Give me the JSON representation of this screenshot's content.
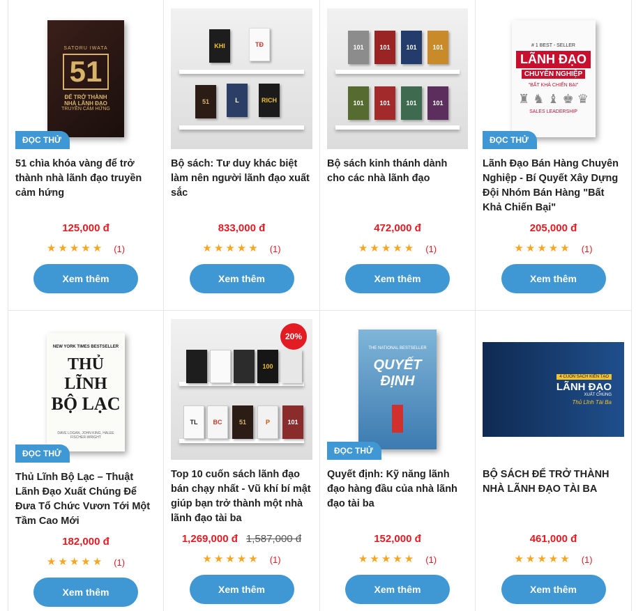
{
  "products": [
    {
      "title": "51 chìa khóa vàng để trở thành nhà lãnh đạo truyền cảm hứng",
      "price": "125,000 đ",
      "rating_count": "(1)",
      "badge": "ĐỌC THỬ",
      "button": "Xem thêm",
      "cover": {
        "author": "SATORU IWATA",
        "big": "51",
        "line1": "ĐỂ TRỞ THÀNH",
        "line2": "NHÀ LÃNH ĐẠO",
        "line3": "TRUYỀN CẢM HỨNG"
      }
    },
    {
      "title": "Bộ sách: Tư duy khác biệt làm nên người lãnh đạo xuất sắc",
      "price": "833,000 đ",
      "rating_count": "(1)",
      "button": "Xem thêm"
    },
    {
      "title": "Bộ sách kinh thánh dành cho các nhà lãnh đạo",
      "price": "472,000 đ",
      "rating_count": "(1)",
      "button": "Xem thêm"
    },
    {
      "title": "Lãnh Đạo Bán Hàng Chuyên Nghiệp - Bí Quyết Xây Dựng Đội Nhóm Bán Hàng \"Bất Khả Chiến Bại\"",
      "price": "205,000 đ",
      "rating_count": "(1)",
      "badge": "ĐỌC THỬ",
      "button": "Xem thêm",
      "cover": {
        "top": "# 1 BEST - SELLER",
        "line1": "LÃNH ĐẠO",
        "line2": "CHUYÊN NGHIỆP",
        "line3": "\"BẤT KHẢ CHIẾN BẠI\"",
        "foot": "SALES LEADERSHIP"
      }
    },
    {
      "title": "Thủ Lĩnh Bộ Lạc – Thuật Lãnh Đạo Xuất Chúng Để Đưa Tổ Chức Vươn Tới Một Tầm Cao Mới",
      "price": "182,000 đ",
      "rating_count": "(1)",
      "badge": "ĐỌC THỬ",
      "button": "Xem thêm",
      "cover": {
        "top": "NEW YORK TIMES BESTSELLER",
        "line1": "THỦ LĨNH",
        "line2": "BỘ LẠC",
        "foot": "DAVE LOGAN, JOHN KING, HALEE FISCHER-WRIGHT"
      }
    },
    {
      "title": "Top 10 cuốn sách lãnh đạo bán chạy nhất - Vũ khí bí mật giúp bạn trở thành một nhà lãnh đạo tài ba",
      "price": "1,269,000 đ",
      "old_price": "1,587,000 đ",
      "discount": "20%",
      "rating_count": "(1)",
      "button": "Xem thêm"
    },
    {
      "title": "Quyết định: Kỹ năng lãnh đạo hàng đầu của nhà lãnh đạo tài ba",
      "price": "152,000 đ",
      "rating_count": "(1)",
      "badge": "ĐỌC THỬ",
      "button": "Xem thêm",
      "cover": {
        "top": "THE NATIONAL BESTSELLER",
        "line1": "QUYẾT ĐỊNH"
      }
    },
    {
      "title": "BỘ SÁCH ĐỂ TRỞ THÀNH NHÀ LÃNH ĐẠO TÀI BA",
      "price": "461,000 đ",
      "rating_count": "(1)",
      "button": "Xem thêm",
      "cover": {
        "line0": "4 CUỐN SÁCH KIẾN TẠO",
        "line1": "LÃNH ĐẠO",
        "line2": "XUẤT CHÚNG",
        "line3": "Thủ Lĩnh Tài Ba"
      }
    }
  ],
  "colors": {
    "accent": "#3f97d3",
    "price": "#e31b23",
    "star": "#f5a623"
  },
  "icons": {
    "star": "star-icon"
  }
}
